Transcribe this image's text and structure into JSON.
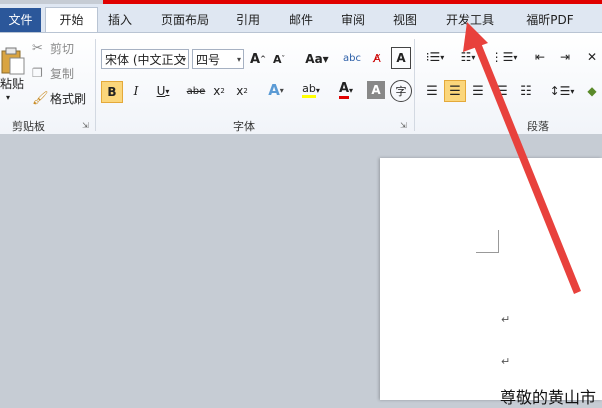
{
  "ribbon_tabs": {
    "file": "文件",
    "home": "开始",
    "insert": "插入",
    "page_layout": "页面布局",
    "references": "引用",
    "mailings": "邮件",
    "review": "审阅",
    "view": "视图",
    "developer": "开发工具",
    "foxit_pdf": "福昕PDF"
  },
  "clipboard": {
    "paste": "粘贴",
    "cut": "剪切",
    "copy": "复制",
    "format_painter": "格式刷",
    "group_label": "剪贴板"
  },
  "font": {
    "font_name": "宋体 (中文正文",
    "font_size": "四号",
    "group_label": "字体"
  },
  "paragraph": {
    "group_label": "段落"
  },
  "document": {
    "para_mark": "↵",
    "visible_text": "尊敬的黄山市"
  },
  "colors": {
    "accent_red": "#e00000",
    "file_tab": "#2b579a",
    "highlight": "#fbd67b"
  }
}
